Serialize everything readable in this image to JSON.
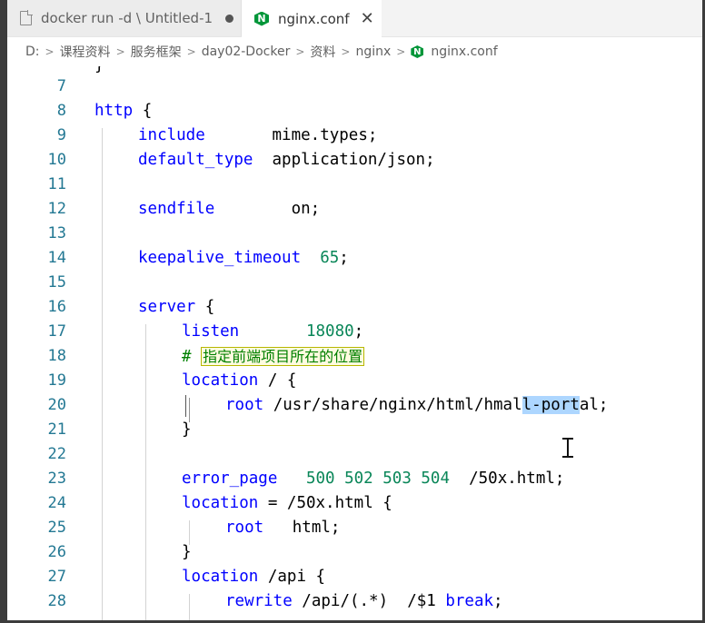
{
  "tabs": [
    {
      "label": "docker run -d \\ Untitled-1",
      "dirty": true,
      "icon": "file-icon"
    },
    {
      "label": "nginx.conf",
      "close": "✕",
      "icon": "nginx-icon",
      "active": true
    }
  ],
  "breadcrumb": {
    "items": [
      "D:",
      "课程资料",
      "服务框架",
      "day02-Docker",
      "资料",
      "nginx"
    ],
    "file": "nginx.conf",
    "separator": ">"
  },
  "colors": {
    "keyword": "#0000ff",
    "number": "#098658",
    "comment": "#008000",
    "line_number": "#237893",
    "selection": "#add6ff",
    "nginx_brand": "#009639"
  },
  "code": {
    "first_partial_line": "}",
    "lines": [
      {
        "n": "7"
      },
      {
        "n": "8",
        "kw": "http",
        "rest": " {"
      },
      {
        "n": "9",
        "kw": "include",
        "rest": "       mime.types;"
      },
      {
        "n": "10",
        "kw": "default_type",
        "rest": "  application/json;"
      },
      {
        "n": "11"
      },
      {
        "n": "12",
        "kw": "sendfile",
        "rest": "        on;"
      },
      {
        "n": "13"
      },
      {
        "n": "14",
        "kw": "keepalive_timeout",
        "sp": "  ",
        "num": "65",
        "tail": ";"
      },
      {
        "n": "15"
      },
      {
        "n": "16",
        "kw": "server",
        "rest": " {"
      },
      {
        "n": "17",
        "kw": "listen",
        "sp": "       ",
        "num": "18080",
        "tail": ";"
      },
      {
        "n": "18",
        "comment_hash": "# ",
        "comment_text": "指定前端项目所在的位置"
      },
      {
        "n": "19",
        "kw": "location",
        "rest": " / {"
      },
      {
        "n": "20",
        "kw": "root",
        "pre_sel": " /usr/share/nginx/html/hmal",
        "sel": "l-port",
        "post_sel": "al;"
      },
      {
        "n": "21",
        "rest": "}"
      },
      {
        "n": "22"
      },
      {
        "n": "23",
        "kw": "error_page",
        "sp": "   ",
        "num": "500 502 503 504",
        "tail": "  /50x.html;"
      },
      {
        "n": "24",
        "kw": "location",
        "rest": " = /50x.html {"
      },
      {
        "n": "25",
        "kw": "root",
        "rest": "   html;"
      },
      {
        "n": "26",
        "rest": "}"
      },
      {
        "n": "27",
        "kw": "location",
        "rest": " /api {"
      },
      {
        "n": "28",
        "kw": "rewrite",
        "pre": " /api/(.*)  /$1 ",
        "kw2": "break",
        "tail": ";"
      }
    ]
  }
}
